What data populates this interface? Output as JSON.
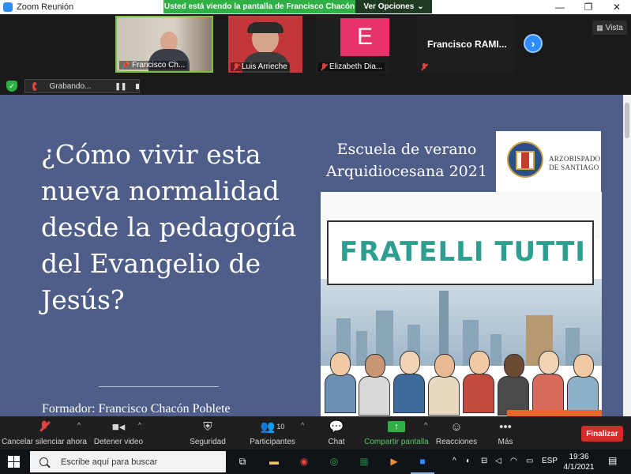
{
  "window": {
    "title": "Zoom Reunión",
    "share_banner": "Usted está viendo la pantalla de Francisco Chacón",
    "view_options": "Ver Opciones"
  },
  "participants": [
    {
      "name": "Francisco Ch...",
      "muted": false
    },
    {
      "name": "Luis Arrieche",
      "muted": true
    },
    {
      "name": "Elizabeth Dia...",
      "muted": true,
      "avatar_letter": "E"
    },
    {
      "name": "Francisco RAMI...",
      "muted": true
    }
  ],
  "view_label": "Vista",
  "recording": {
    "label": "Grabando..."
  },
  "slide": {
    "title": "¿Cómo vivir esta nueva normalidad desde la pedagogía del Evangelio de Jesús?",
    "author": "Formador: Francisco Chacón Poblete",
    "school": "Escuela de verano Arquidiocesana 2021",
    "logo_text_1": "Arzobispado",
    "logo_text_2": "de Santiago",
    "banner": "FRATELLI TUTTI"
  },
  "toolbar": {
    "unmute": "Cancelar silenciar ahora",
    "stop_video": "Detener video",
    "security": "Seguridad",
    "participants": "Participantes",
    "participants_count": "10",
    "chat": "Chat",
    "share": "Compartir pantalla",
    "reactions": "Reacciones",
    "more": "Más",
    "end": "Finalizar"
  },
  "taskbar": {
    "search_placeholder": "Escribe aquí para buscar",
    "lang": "ESP",
    "time": "19:36",
    "date": "4/1/2021"
  },
  "colors": {
    "slide_bg": "#4e5e89",
    "zoom_blue": "#2d8cff",
    "share_green": "#2fb045",
    "end_red": "#d32a2a",
    "banner_teal": "#2e9e91"
  }
}
